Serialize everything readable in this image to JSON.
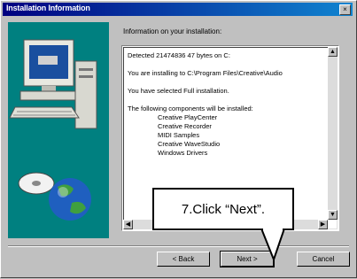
{
  "window": {
    "title": "Installation Information",
    "close_glyph": "×"
  },
  "main": {
    "heading": "Information on your installation:",
    "info_lines": [
      "Detected 21474836 47 bytes on C:",
      "You are installing to C:\\Program Files\\Creative\\Audio",
      "You have selected Full installation.",
      "The following components will be installed:"
    ],
    "components": [
      "Creative PlayCenter",
      "Creative Recorder",
      "MIDI Samples",
      "Creative WaveStudio",
      "Windows Drivers"
    ]
  },
  "buttons": {
    "back": "< Back",
    "next": "Next >",
    "cancel": "Cancel"
  },
  "callout": {
    "text": "7.Click “Next”."
  },
  "icons": {
    "artwork": "computer-with-globe-illustration"
  },
  "colors": {
    "titlebar": "#000080",
    "art_background": "#008080"
  }
}
